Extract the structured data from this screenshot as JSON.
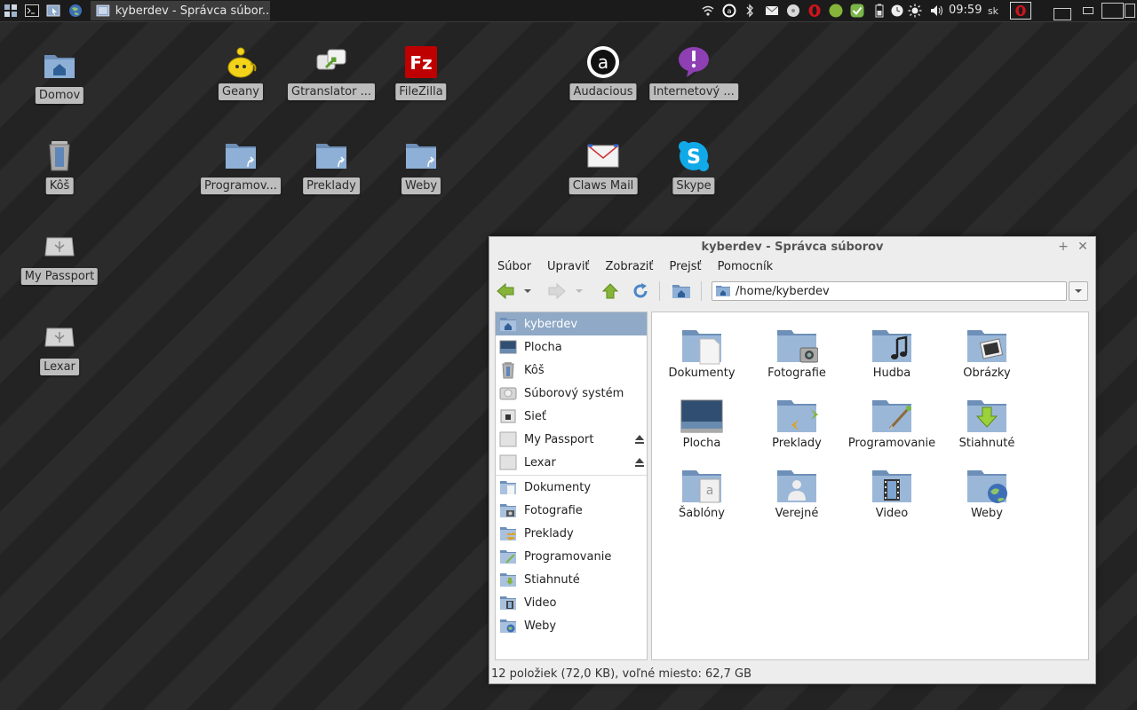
{
  "panel": {
    "task_title": "kyberdev - Správca súbor...",
    "clock": "09:59",
    "launcher_icons": [
      "system-menu-icon",
      "terminal-icon",
      "file-manager-icon",
      "web-browser-icon"
    ],
    "tray_icons": [
      "wifi-icon",
      "audacious-tray-icon",
      "bluetooth-icon",
      "mail-icon",
      "disk-icon",
      "opera-icon",
      "green-circle-icon",
      "checkmark-icon",
      "battery-icon",
      "clock-icon",
      "brightness-icon",
      "volume-icon"
    ],
    "keyboard_layout": "sk"
  },
  "desktop": {
    "icons": [
      {
        "label": "Domov",
        "icon": "home-folder-icon"
      },
      {
        "label": "Kôš",
        "icon": "trash-icon"
      },
      {
        "label": "My Passport",
        "icon": "usb-drive-icon"
      },
      {
        "label": "Lexar",
        "icon": "usb-drive-icon"
      },
      {
        "label": "Geany",
        "icon": "geany-icon"
      },
      {
        "label": "Gtranslator ...",
        "icon": "gtranslator-icon"
      },
      {
        "label": "FileZilla",
        "icon": "filezilla-icon"
      },
      {
        "label": "Audacious",
        "icon": "audacious-icon"
      },
      {
        "label": "Internetový ...",
        "icon": "messenger-icon"
      },
      {
        "label": "Programov...",
        "icon": "folder-link-icon"
      },
      {
        "label": "Preklady",
        "icon": "folder-link-icon"
      },
      {
        "label": "Weby",
        "icon": "folder-link-icon"
      },
      {
        "label": "Claws Mail",
        "icon": "claws-mail-icon"
      },
      {
        "label": "Skype",
        "icon": "skype-icon"
      }
    ]
  },
  "window": {
    "title": "kyberdev - Správca súborov",
    "menu": [
      "Súbor",
      "Upraviť",
      "Zobraziť",
      "Prejsť",
      "Pomocník"
    ],
    "path": "/home/kyberdev",
    "sidebar": [
      {
        "label": "kyberdev",
        "icon": "home-folder-icon",
        "selected": true
      },
      {
        "label": "Plocha",
        "icon": "desktop-icon"
      },
      {
        "label": "Kôš",
        "icon": "trash-icon"
      },
      {
        "label": "Súborový systém",
        "icon": "drive-icon"
      },
      {
        "label": "Sieť",
        "icon": "network-icon"
      },
      {
        "label": "My Passport",
        "icon": "removable-drive-icon",
        "eject": true
      },
      {
        "label": "Lexar",
        "icon": "removable-drive-icon",
        "eject": true
      },
      {
        "label": "Dokumenty",
        "icon": "documents-folder-icon"
      },
      {
        "label": "Fotografie",
        "icon": "pictures-folder-icon"
      },
      {
        "label": "Preklady",
        "icon": "translate-folder-icon"
      },
      {
        "label": "Programovanie",
        "icon": "programming-folder-icon"
      },
      {
        "label": "Stiahnuté",
        "icon": "downloads-folder-icon"
      },
      {
        "label": "Video",
        "icon": "video-folder-icon"
      },
      {
        "label": "Weby",
        "icon": "web-folder-icon"
      }
    ],
    "files": [
      {
        "label": "Dokumenty",
        "icon": "documents-folder-icon"
      },
      {
        "label": "Fotografie",
        "icon": "camera-folder-icon"
      },
      {
        "label": "Hudba",
        "icon": "music-folder-icon"
      },
      {
        "label": "Obrázky",
        "icon": "pictures-folder-icon"
      },
      {
        "label": "Plocha",
        "icon": "desktop-folder-icon"
      },
      {
        "label": "Preklady",
        "icon": "translate-folder-icon"
      },
      {
        "label": "Programovanie",
        "icon": "programming-folder-icon"
      },
      {
        "label": "Stiahnuté",
        "icon": "downloads-folder-icon"
      },
      {
        "label": "Šablóny",
        "icon": "templates-folder-icon"
      },
      {
        "label": "Verejné",
        "icon": "public-folder-icon"
      },
      {
        "label": "Video",
        "icon": "video-folder-icon"
      },
      {
        "label": "Weby",
        "icon": "web-folder-icon"
      }
    ],
    "status": "12 položiek (72,0 KB), voľné miesto: 62,7 GB"
  },
  "colors": {
    "selection": "#8fa9c6",
    "folder": "#7f9fc4",
    "panel": "#1b1b1b",
    "desktop": "#2b2b2b"
  }
}
